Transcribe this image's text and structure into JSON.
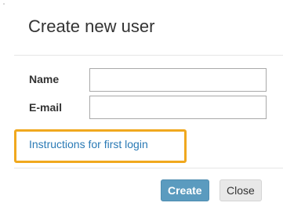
{
  "dialog": {
    "title": "Create new user",
    "fields": {
      "name": {
        "label": "Name",
        "value": ""
      },
      "email": {
        "label": "E-mail",
        "value": ""
      }
    },
    "instructions_link": "Instructions for first login",
    "buttons": {
      "create_label": "Create",
      "close_label": "Close"
    }
  },
  "colors": {
    "highlight": "#f0a81e",
    "link": "#2a7ab5",
    "primary_button": "#5b9bbf",
    "secondary_button": "#e8e8e8"
  }
}
